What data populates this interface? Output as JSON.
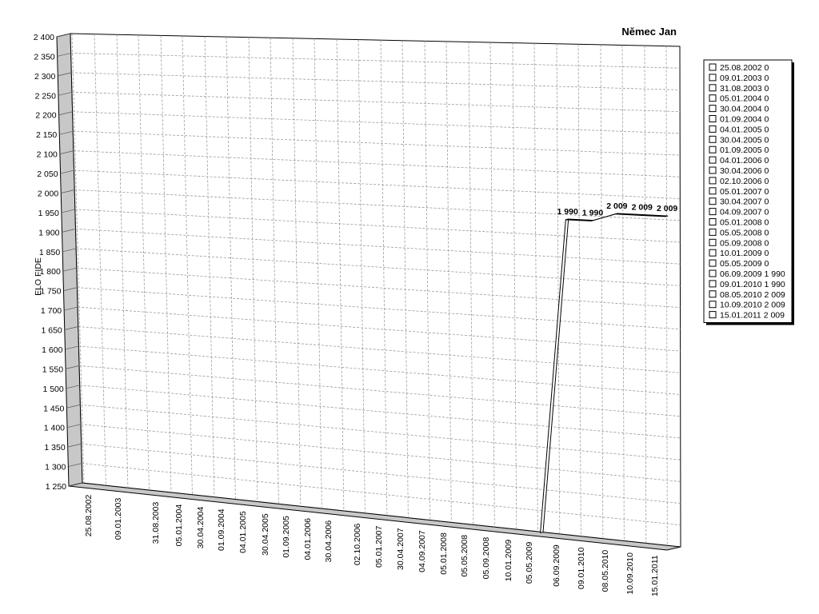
{
  "chart_data": {
    "type": "line",
    "title": "Němec Jan",
    "xlabel": "",
    "ylabel": "ELO FIDE",
    "ylim": [
      1250,
      2400
    ],
    "ytick_step": 50,
    "grid": true,
    "legend_position": "right",
    "x": [
      "25.08.2002",
      "09.01.2003",
      "31.08.2003",
      "05.01.2004",
      "30.04.2004",
      "01.09.2004",
      "04.01.2005",
      "30.04.2005",
      "01.09.2005",
      "04.01.2006",
      "30.04.2006",
      "02.10.2006",
      "05.01.2007",
      "30.04.2007",
      "04.09.2007",
      "05.01.2008",
      "05.05.2008",
      "05.09.2008",
      "10.01.2009",
      "05.05.2009",
      "06.09.2009",
      "09.01.2010",
      "08.05.2010",
      "10.09.2010",
      "15.01.2011"
    ],
    "series": [
      {
        "values": [
          0,
          0,
          0,
          0,
          0,
          0,
          0,
          0,
          0,
          0,
          0,
          0,
          0,
          0,
          0,
          0,
          0,
          0,
          0,
          0,
          1990,
          1990,
          2009,
          2009,
          2009
        ],
        "data_labels": [
          "",
          "",
          "",
          "",
          "",
          "",
          "",
          "",
          "",
          "",
          "",
          "",
          "",
          "",
          "",
          "",
          "",
          "",
          "",
          "",
          "1 990",
          "1 990",
          "2 009",
          "2 009",
          "2 009"
        ]
      }
    ],
    "legend": [
      "25.08.2002 0",
      "09.01.2003 0",
      "31.08.2003 0",
      "05.01.2004 0",
      "30.04.2004 0",
      "01.09.2004 0",
      "04.01.2005 0",
      "30.04.2005 0",
      "01.09.2005 0",
      "04.01.2006 0",
      "30.04.2006 0",
      "02.10.2006 0",
      "05.01.2007 0",
      "30.04.2007 0",
      "04.09.2007 0",
      "05.01.2008 0",
      "05.05.2008 0",
      "05.09.2008 0",
      "10.01.2009 0",
      "05.05.2009 0",
      "06.09.2009 1 990",
      "09.01.2010 1 990",
      "08.05.2010 2 009",
      "10.09.2010 2 009",
      "15.01.2011 2 009"
    ],
    "colors": {
      "grid": "#9a9a9a",
      "wall": "#c8c8c8",
      "line": "#000000",
      "legend_border": "#000000"
    }
  }
}
